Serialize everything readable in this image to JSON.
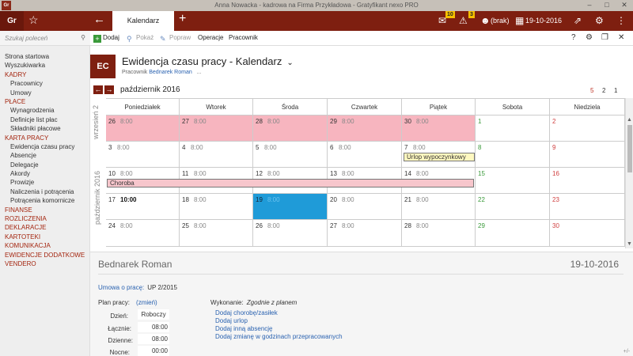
{
  "window": {
    "title": "Anna Nowacka - kadrowa na Firma Przykładowa - Gratyfikant nexo PRO",
    "app_icon": "Gr"
  },
  "appbar": {
    "logo": "Gr",
    "tab_label": "Kalendarz",
    "badge_messages": "10",
    "badge_alerts": "3",
    "user_label": "(brak)",
    "date": "19-10-2016"
  },
  "toolbar": {
    "add": "Dodaj",
    "show": "Pokaż",
    "edit": "Popraw",
    "operations": "Operacje",
    "employee": "Pracownik",
    "help": "?"
  },
  "sidebar": {
    "search_placeholder": "Szukaj poleceń",
    "items": [
      {
        "label": "Strona startowa",
        "kind": "lvl1"
      },
      {
        "label": "Wyszukiwarka",
        "kind": "lvl1"
      },
      {
        "label": "KADRY",
        "kind": "sec"
      },
      {
        "label": "Pracownicy",
        "kind": "lvl2"
      },
      {
        "label": "Umowy",
        "kind": "lvl2"
      },
      {
        "label": "PŁACE",
        "kind": "sec"
      },
      {
        "label": "Wynagrodzenia",
        "kind": "lvl2"
      },
      {
        "label": "Definicje list płac",
        "kind": "lvl2"
      },
      {
        "label": "Składniki płacowe",
        "kind": "lvl2"
      },
      {
        "label": "KARTA PRACY",
        "kind": "sec"
      },
      {
        "label": "Ewidencja czasu pracy",
        "kind": "lvl2"
      },
      {
        "label": "Absencje",
        "kind": "lvl2"
      },
      {
        "label": "Delegacje",
        "kind": "lvl2"
      },
      {
        "label": "Akordy",
        "kind": "lvl2"
      },
      {
        "label": "Prowizje",
        "kind": "lvl2"
      },
      {
        "label": "Naliczenia i potrącenia",
        "kind": "lvl2"
      },
      {
        "label": "Potrącenia komornicze",
        "kind": "lvl2"
      },
      {
        "label": "FINANSE",
        "kind": "sec"
      },
      {
        "label": "ROZLICZENIA",
        "kind": "sec"
      },
      {
        "label": "DEKLARACJE",
        "kind": "sec"
      },
      {
        "label": "KARTOTEKI",
        "kind": "sec"
      },
      {
        "label": "KOMUNIKACJA",
        "kind": "sec"
      },
      {
        "label": "EWIDENCJE DODATKOWE",
        "kind": "sec"
      },
      {
        "label": "VENDERO",
        "kind": "sec"
      }
    ]
  },
  "header": {
    "badge": "EC",
    "title": "Ewidencja czasu pracy - Kalendarz",
    "sub_label": "Pracownik",
    "sub_value": "Bednarek Roman",
    "sub_more": "..."
  },
  "calendar": {
    "month_label": "październik 2016",
    "pages": [
      "5",
      "2",
      "1"
    ],
    "side_labels": [
      "wrzesień 2",
      "październik 2016"
    ],
    "weekdays": [
      "Poniedziałek",
      "Wtorek",
      "Środa",
      "Czwartek",
      "Piątek",
      "Sobota",
      "Niedziela"
    ],
    "weeks": [
      [
        {
          "d": "26",
          "h": "8:00",
          "c": "pink"
        },
        {
          "d": "27",
          "h": "8:00",
          "c": "pink"
        },
        {
          "d": "28",
          "h": "8:00",
          "c": "pink"
        },
        {
          "d": "29",
          "h": "8:00",
          "c": "pink"
        },
        {
          "d": "30",
          "h": "8:00",
          "c": "pink"
        },
        {
          "d": "1",
          "h": "",
          "c": "sat"
        },
        {
          "d": "2",
          "h": "",
          "c": "sun"
        }
      ],
      [
        {
          "d": "3",
          "h": "8:00",
          "c": ""
        },
        {
          "d": "4",
          "h": "8:00",
          "c": ""
        },
        {
          "d": "5",
          "h": "8:00",
          "c": ""
        },
        {
          "d": "6",
          "h": "8:00",
          "c": ""
        },
        {
          "d": "7",
          "h": "8:00",
          "c": ""
        },
        {
          "d": "8",
          "h": "",
          "c": "sat"
        },
        {
          "d": "9",
          "h": "",
          "c": "sun"
        }
      ],
      [
        {
          "d": "10",
          "h": "8:00",
          "c": ""
        },
        {
          "d": "11",
          "h": "8:00",
          "c": ""
        },
        {
          "d": "12",
          "h": "8:00",
          "c": ""
        },
        {
          "d": "13",
          "h": "8:00",
          "c": ""
        },
        {
          "d": "14",
          "h": "8:00",
          "c": ""
        },
        {
          "d": "15",
          "h": "",
          "c": "sat"
        },
        {
          "d": "16",
          "h": "",
          "c": "sun"
        }
      ],
      [
        {
          "d": "17",
          "h": "10:00",
          "c": "bold"
        },
        {
          "d": "18",
          "h": "8:00",
          "c": ""
        },
        {
          "d": "19",
          "h": "8:00",
          "c": "blue"
        },
        {
          "d": "20",
          "h": "8:00",
          "c": ""
        },
        {
          "d": "21",
          "h": "8:00",
          "c": ""
        },
        {
          "d": "22",
          "h": "",
          "c": "sat"
        },
        {
          "d": "23",
          "h": "",
          "c": "sun"
        }
      ],
      [
        {
          "d": "24",
          "h": "8:00",
          "c": ""
        },
        {
          "d": "25",
          "h": "8:00",
          "c": ""
        },
        {
          "d": "26",
          "h": "8:00",
          "c": ""
        },
        {
          "d": "27",
          "h": "8:00",
          "c": ""
        },
        {
          "d": "28",
          "h": "8:00",
          "c": ""
        },
        {
          "d": "29",
          "h": "",
          "c": "sat"
        },
        {
          "d": "30",
          "h": "",
          "c": "sun"
        }
      ]
    ],
    "events": {
      "vacation": "Urlop wypoczynkowy",
      "sick": "Choroba"
    }
  },
  "detail": {
    "name": "Bednarek Roman",
    "date": "19-10-2016",
    "contract_label": "Umowa o pracę:",
    "contract_value": "UP 2/2015",
    "plan_label": "Plan pracy:",
    "plan_change": "(zmień)",
    "rows": [
      {
        "label": "Dzień:",
        "value": "Roboczy"
      },
      {
        "label": "Łącznie:",
        "value": "08:00"
      },
      {
        "label": "Dzienne:",
        "value": "08:00"
      },
      {
        "label": "Nocne:",
        "value": "00:00"
      }
    ],
    "execution_label": "Wykonanie:",
    "execution_value": "Zgodnie z planem",
    "links": [
      "Dodaj chorobę/zasiłek",
      "Dodaj urlop",
      "Dodaj inną absencję",
      "Dodaj zmianę w godzinach przepracowanych"
    ],
    "corner": "+/-"
  }
}
